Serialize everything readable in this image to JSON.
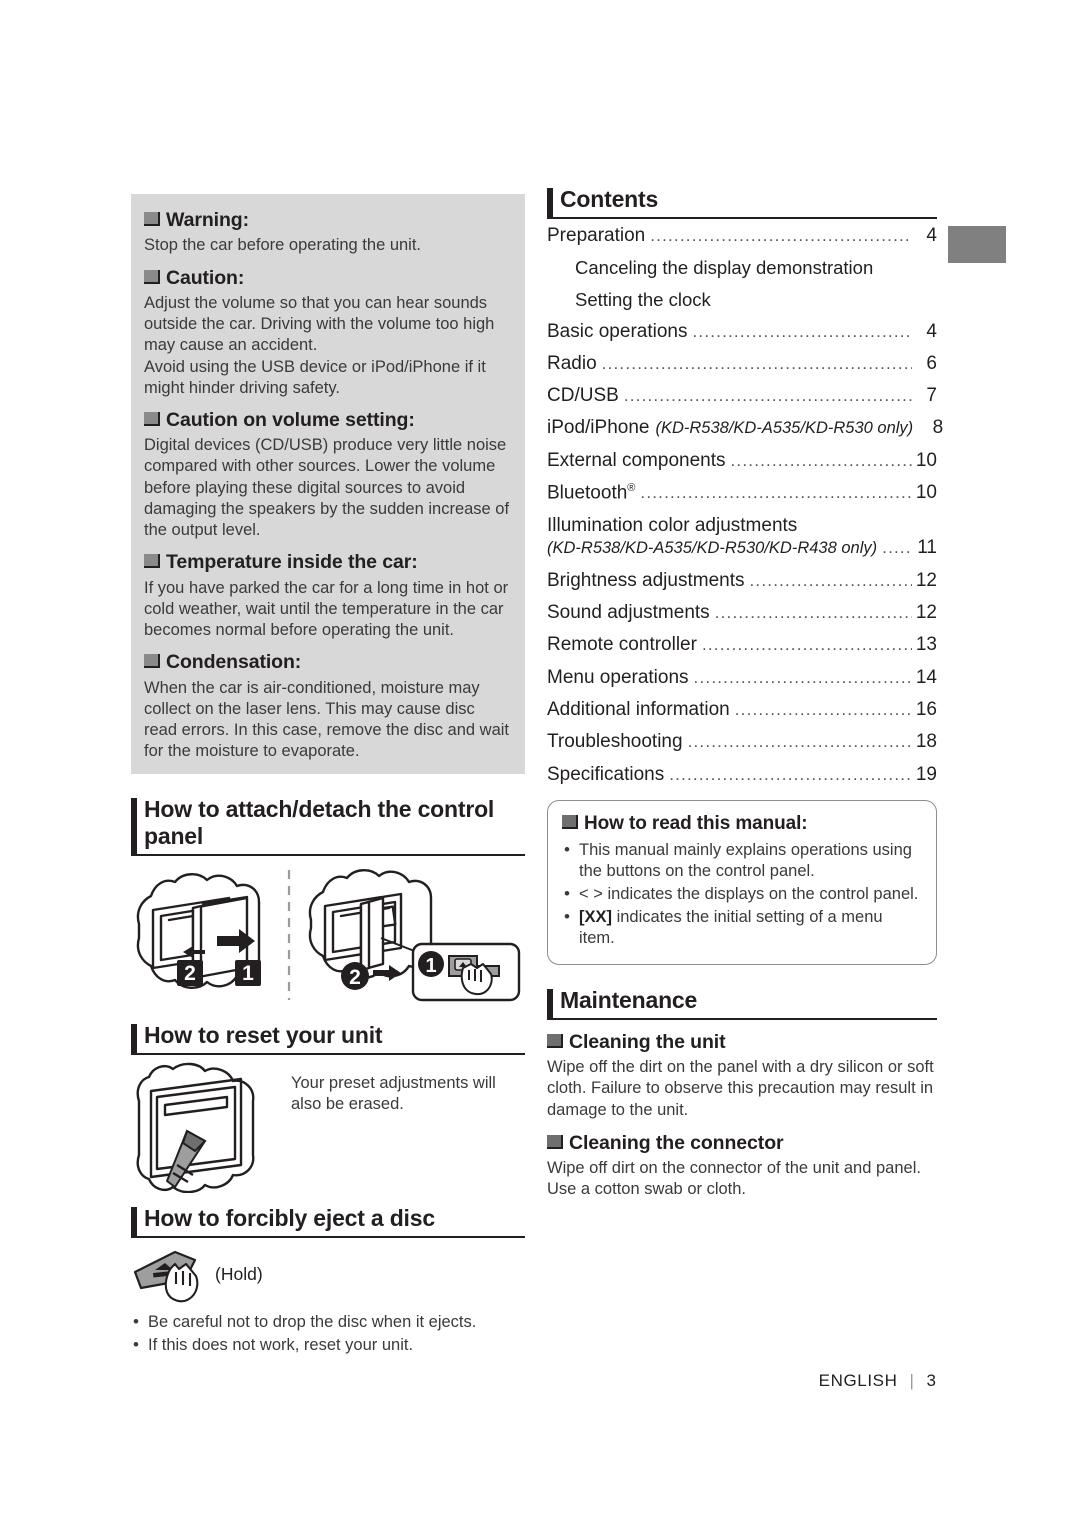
{
  "cautions": {
    "warning": {
      "heading": "Warning:",
      "text": "Stop the car before operating the unit."
    },
    "caution": {
      "heading": "Caution:",
      "para1": "Adjust the volume so that you can hear sounds outside the car. Driving with the volume too high may cause an accident.",
      "para2": "Avoid using the USB device or iPod/iPhone if it might hinder driving safety."
    },
    "volume": {
      "heading": "Caution on volume setting:",
      "text": "Digital devices (CD/USB) produce very little noise compared with other sources. Lower the volume before playing these digital sources to avoid damaging the speakers by the sudden increase of the output level."
    },
    "temperature": {
      "heading": "Temperature inside the car:",
      "text": "If you have parked the car for a long time in hot or cold weather, wait until the temperature in the car becomes normal before operating the unit."
    },
    "condensation": {
      "heading": "Condensation:",
      "text": "When the car is air-conditioned, moisture may collect on the laser lens. This may cause disc read errors. In this case, remove the disc and wait for the moisture to evaporate."
    }
  },
  "sections": {
    "attach_detach": {
      "title": "How to attach/detach the control panel"
    },
    "reset": {
      "title": "How to reset your unit",
      "note": "Your preset adjustments will also be erased."
    },
    "eject": {
      "title": "How to forcibly eject a disc",
      "hold_label": "(Hold)",
      "bullets": [
        "Be careful not to drop the disc when it ejects.",
        "If this does not work, reset your unit."
      ]
    },
    "contents": {
      "title": "Contents"
    },
    "maintenance": {
      "title": "Maintenance"
    }
  },
  "figures": {
    "attach_step_1": "1",
    "attach_step_2": "2",
    "detach_step_1": "1",
    "detach_step_2": "2"
  },
  "contents": [
    {
      "label": "Preparation",
      "page": "4",
      "type": "entry"
    },
    {
      "label": "Canceling the display demonstration",
      "type": "sub"
    },
    {
      "label": "Setting the clock",
      "type": "sub"
    },
    {
      "label": "Basic operations",
      "page": "4",
      "type": "entry"
    },
    {
      "label": "Radio",
      "page": "6",
      "type": "entry"
    },
    {
      "label": "CD/USB",
      "page": "7",
      "type": "entry"
    },
    {
      "label": "iPod/iPhone",
      "note": "(KD-R538/KD-A535/KD-R530 only)",
      "page": "8",
      "type": "entry-note"
    },
    {
      "label": "External components",
      "page": "10",
      "type": "entry"
    },
    {
      "label": "Bluetooth",
      "sup": "®",
      "page": "10",
      "type": "entry-sup"
    },
    {
      "label": "Illumination color adjustments",
      "note": "(KD-R538/KD-A535/KD-R530/KD-R438 only)",
      "page": "11",
      "type": "entry-twoline"
    },
    {
      "label": "Brightness adjustments",
      "page": "12",
      "type": "entry"
    },
    {
      "label": "Sound adjustments",
      "page": "12",
      "type": "entry"
    },
    {
      "label": "Remote controller",
      "page": "13",
      "type": "entry"
    },
    {
      "label": "Menu operations",
      "page": "14",
      "type": "entry"
    },
    {
      "label": "Additional information",
      "page": "16",
      "type": "entry"
    },
    {
      "label": "Troubleshooting",
      "page": "18",
      "type": "entry"
    },
    {
      "label": "Specifications",
      "page": "19",
      "type": "entry"
    }
  ],
  "how_to_read": {
    "heading": "How to read this manual:",
    "bullets": [
      "This manual mainly explains operations using the buttons on the control panel.",
      "< > indicates the displays on the control panel."
    ],
    "bullet3_bold": "[XX]",
    "bullet3_rest": " indicates the initial setting of a menu item."
  },
  "maintenance": {
    "cleaning_unit": {
      "heading": "Cleaning the unit",
      "text": "Wipe off the dirt on the panel with a dry silicon or soft cloth. Failure to observe this precaution may result in damage to the unit."
    },
    "cleaning_connector": {
      "heading": "Cleaning the connector",
      "text": "Wipe off dirt on the connector of the unit and panel. Use a cotton swab or cloth."
    }
  },
  "footer": {
    "language": "ENGLISH",
    "separator": "|",
    "page_number": "3"
  },
  "colors": {
    "panel_gray": "#d8d8d8",
    "tab_gray": "#808080",
    "ink": "#231f20",
    "body_ink": "#3a3a3a"
  }
}
